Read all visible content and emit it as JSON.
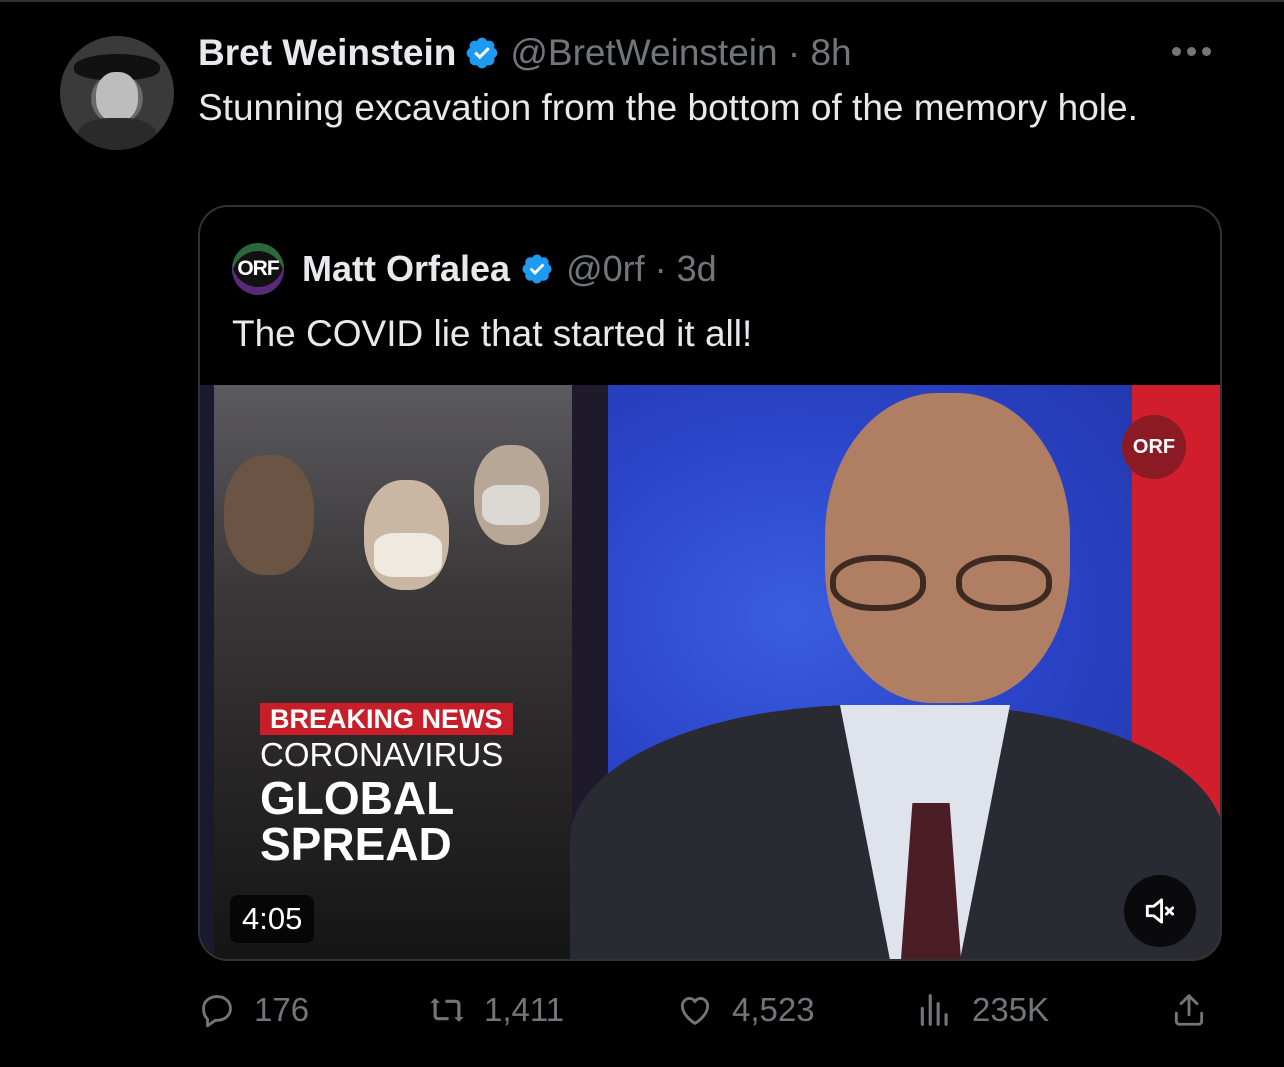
{
  "tweet": {
    "author_name": "Bret Weinstein",
    "author_handle": "@BretWeinstein · 8h",
    "text": "Stunning excavation from the bottom of the memory hole.",
    "more_icon": "ellipsis-icon",
    "avatar_icon": "avatar-image"
  },
  "quote": {
    "author_name": "Matt Orfalea",
    "author_handle": "@0rf · 3d",
    "avatar_text": "ORF",
    "text": "The COVID lie that started it all!",
    "media": {
      "breaking": "BREAKING NEWS",
      "line1": "CORONAVIRUS",
      "line2": "GLOBAL",
      "line3": "SPREAD",
      "duration": "4:05",
      "watermark": "ORF",
      "mute_icon": "speaker-muted-icon"
    }
  },
  "actions": {
    "replies": "176",
    "retweets": "1,411",
    "likes": "4,523",
    "views": "235K"
  },
  "colors": {
    "background": "#000000",
    "text": "#e7e9ea",
    "muted": "#71767b",
    "verified": "#1d9bf0",
    "border": "#2f3336"
  }
}
